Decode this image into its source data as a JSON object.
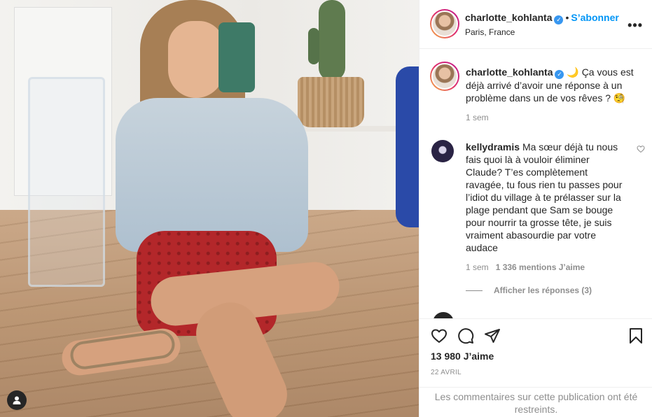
{
  "post": {
    "username": "charlotte_kohlanta",
    "follow_label": "S’abonner",
    "separator": "•",
    "location": "Paris, France",
    "more_label": "•••"
  },
  "caption": {
    "username": "charlotte_kohlanta",
    "text": "🌙 Ça vous est déjà arrivé d’avoir une réponse à un problème dans un de vos rêves ? 🧐",
    "time": "1 sem"
  },
  "comment": {
    "username": "kellydramis",
    "text": "Ma sœur déjà tu nous fais quoi là à vouloir éliminer Claude? T’es complètement ravagée, tu fous rien tu passes pour l’idiot du village à te prélasser sur la plage pendant que Sam se bouge pour nourrir ta grosse tête, je suis vraiment abasourdie par votre audace",
    "time": "1 sem",
    "likes": "1 336 mentions J’aime",
    "replies_label": "Afficher les réponses (3)"
  },
  "actions": {
    "likes_count": "13 980 J’aime",
    "date": "22 AVRIL",
    "restricted_notice": "Les commentaires sur cette publication ont été restreints."
  },
  "icons": {
    "verified": "verified-badge-icon",
    "like": "heart-icon",
    "comment": "comment-bubble-icon",
    "share": "paper-plane-icon",
    "save": "bookmark-icon",
    "tag": "user-tag-icon"
  },
  "colors": {
    "accent": "#0095f6",
    "verified": "#3897f0",
    "text": "#262626",
    "muted": "#8e8e8e"
  }
}
